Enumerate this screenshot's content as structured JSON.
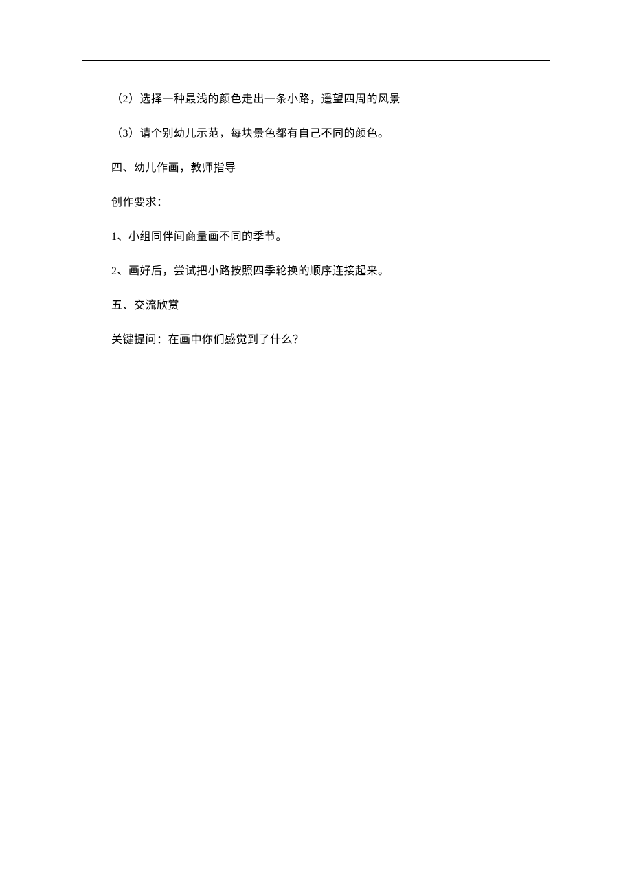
{
  "lines": {
    "line1": "（2）选择一种最浅的颜色走出一条小路，遥望四周的风景",
    "line2": "（3）请个别幼儿示范，每块景色都有自己不同的颜色。",
    "line3": "四、幼儿作画，教师指导",
    "line4": "创作要求：",
    "line5": "1、小组同伴间商量画不同的季节。",
    "line6": "2、画好后，尝试把小路按照四季轮换的顺序连接起来。",
    "line7": "五、交流欣赏",
    "line8": "关键提问：在画中你们感觉到了什么？"
  }
}
